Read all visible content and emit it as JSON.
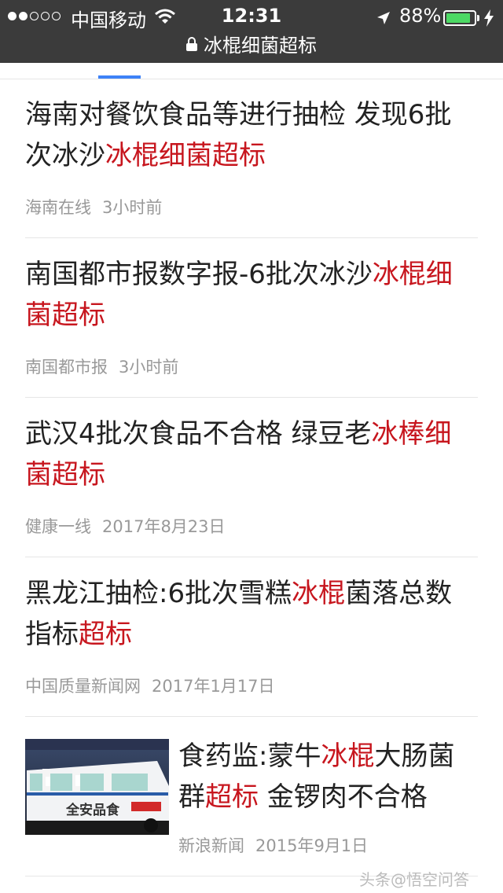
{
  "status_bar": {
    "carrier": "中国移动",
    "time": "12:31",
    "battery_percent": "88%",
    "battery_level": 0.88,
    "signal_bars_filled": 2,
    "signal_bars_total": 5
  },
  "url_bar": {
    "title": "冰棍细菌超标"
  },
  "colors": {
    "highlight": "#c7161e",
    "tab_indicator": "#3e82f7",
    "meta": "#999999"
  },
  "results": [
    {
      "title_parts": [
        {
          "text": "海南对餐饮食品等进行抽检 发现6批次冰沙",
          "hl": false
        },
        {
          "text": "冰棍细菌超标",
          "hl": true
        }
      ],
      "source": "海南在线",
      "time": "3小时前"
    },
    {
      "title_parts": [
        {
          "text": "南国都市报数字报-6批次冰沙",
          "hl": false
        },
        {
          "text": "冰棍细菌超标",
          "hl": true
        }
      ],
      "source": "南国都市报",
      "time": "3小时前"
    },
    {
      "title_parts": [
        {
          "text": "武汉4批次食品不合格 绿豆老",
          "hl": false
        },
        {
          "text": "冰棒细菌超标",
          "hl": true
        }
      ],
      "source": "健康一线",
      "time": "2017年8月23日"
    },
    {
      "title_parts": [
        {
          "text": "黑龙江抽检:6批次雪糕",
          "hl": false
        },
        {
          "text": "冰棍",
          "hl": true
        },
        {
          "text": "菌落总数指标",
          "hl": false
        },
        {
          "text": "超标",
          "hl": true
        }
      ],
      "source": "中国质量新闻网",
      "time": "2017年1月17日"
    },
    {
      "title_parts": [
        {
          "text": "食药监:蒙牛",
          "hl": false
        },
        {
          "text": "冰棍",
          "hl": true
        },
        {
          "text": "大肠菌群",
          "hl": false
        },
        {
          "text": "超标",
          "hl": true
        },
        {
          "text": " 金锣肉不合格",
          "hl": false
        }
      ],
      "source": "新浪新闻",
      "time": "2015年9月1日",
      "thumbnail": {
        "banner_text": "全安品食"
      }
    }
  ],
  "watermark": {
    "text": "头条@悟空问答"
  }
}
